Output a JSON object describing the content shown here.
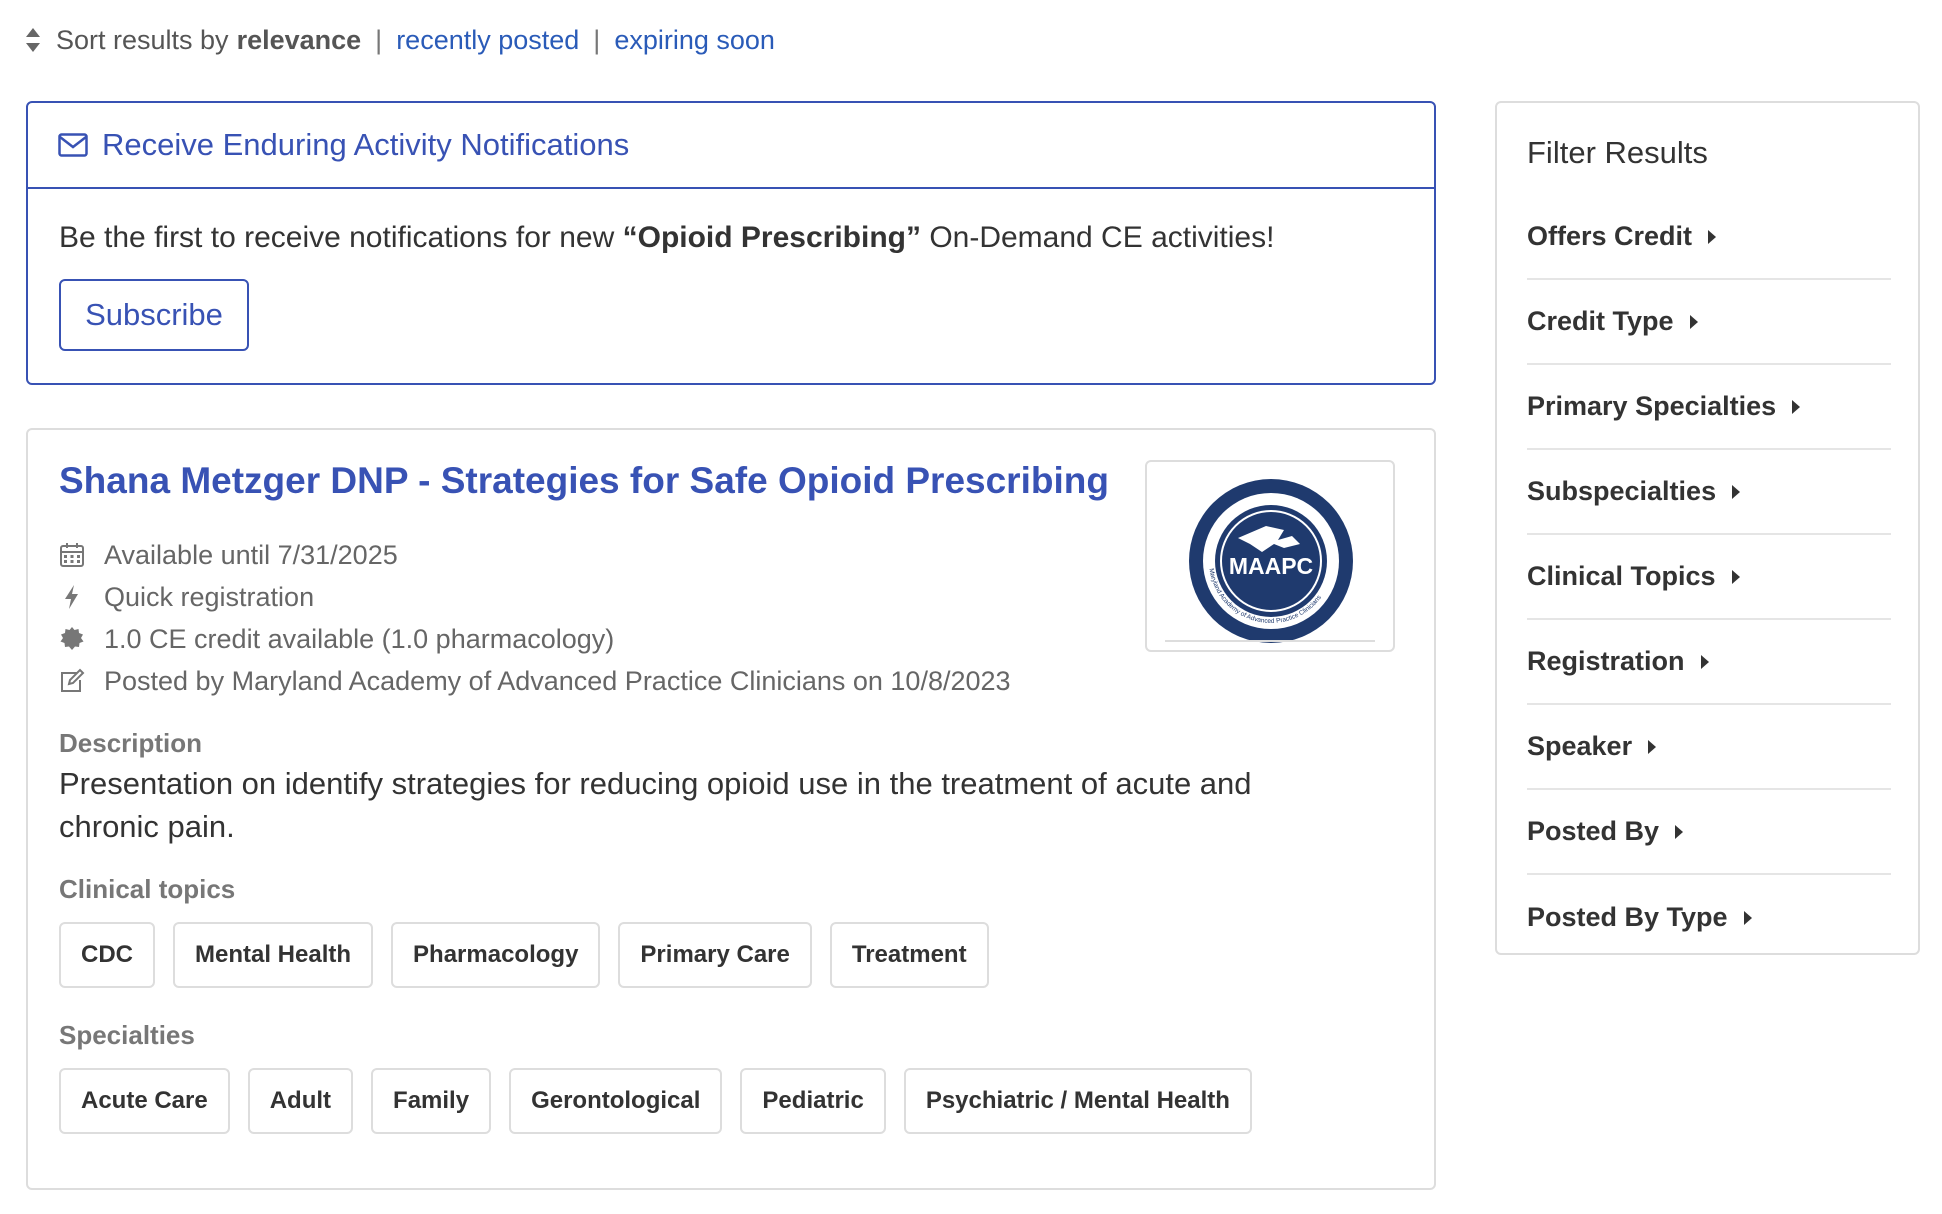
{
  "sort": {
    "prefix": "Sort results by",
    "current": "relevance",
    "options": [
      "recently posted",
      "expiring soon"
    ]
  },
  "notification": {
    "title": "Receive Enduring Activity Notifications",
    "text_before": "Be the first to receive notifications for new ",
    "topic": "“Opioid Prescribing”",
    "text_after": " On-Demand CE activities!",
    "button": "Subscribe"
  },
  "activity": {
    "title": "Shana Metzger DNP - Strategies for Safe Opioid Prescribing",
    "logo_text": "MAAPC",
    "logo_ring_text": "Maryland Academy of Advanced Practice Clinicians",
    "meta": [
      {
        "icon": "calendar-icon",
        "text": "Available until 7/31/2025"
      },
      {
        "icon": "bolt-icon",
        "text": "Quick registration"
      },
      {
        "icon": "certificate-icon",
        "text": "1.0 CE credit available (1.0 pharmacology)"
      },
      {
        "icon": "edit-icon",
        "text": "Posted by Maryland Academy of Advanced Practice Clinicians on 10/8/2023"
      }
    ],
    "description_label": "Description",
    "description": "Presentation on identify strategies for reducing opioid use in the treatment of acute and chronic pain.",
    "clinical_topics_label": "Clinical topics",
    "clinical_topics": [
      "CDC",
      "Mental Health",
      "Pharmacology",
      "Primary Care",
      "Treatment"
    ],
    "specialties_label": "Specialties",
    "specialties": [
      "Acute Care",
      "Adult",
      "Family",
      "Gerontological",
      "Pediatric",
      "Psychiatric / Mental Health"
    ]
  },
  "filters": {
    "title": "Filter Results",
    "items": [
      "Offers Credit",
      "Credit Type",
      "Primary Specialties",
      "Subspecialties",
      "Clinical Topics",
      "Registration",
      "Speaker",
      "Posted By",
      "Posted By Type"
    ]
  },
  "colors": {
    "brand_blue": "#3852b4",
    "link_blue": "#2a5bb8",
    "logo_navy": "#1f3a6e"
  }
}
